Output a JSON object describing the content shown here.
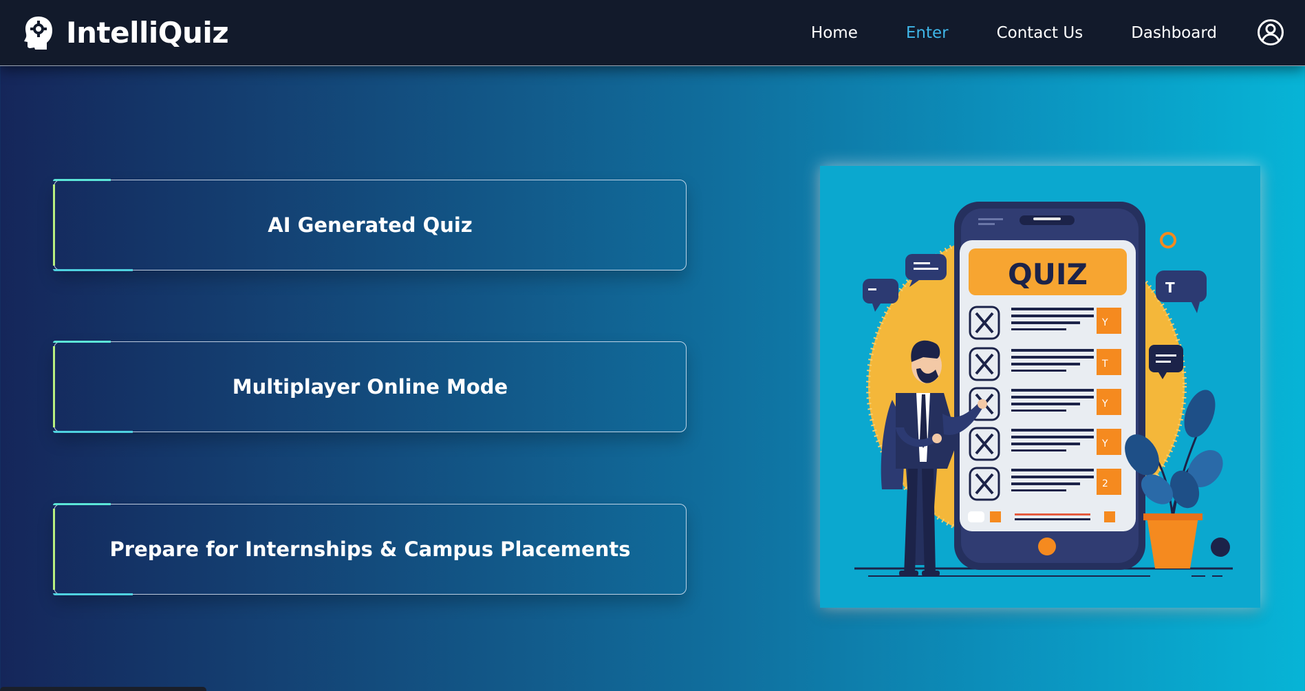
{
  "brand": {
    "name": "IntelliQuiz",
    "logo_icon": "brain-gear-icon"
  },
  "nav": {
    "items": [
      {
        "label": "Home",
        "active": false
      },
      {
        "label": "Enter",
        "active": true
      },
      {
        "label": "Contact Us",
        "active": false
      },
      {
        "label": "Dashboard",
        "active": false
      }
    ],
    "user_icon": "user-circle-icon",
    "active_color": "#3fb6e8"
  },
  "features": [
    {
      "label": "AI Generated Quiz"
    },
    {
      "label": "Multiplayer Online Mode"
    },
    {
      "label": "Prepare for Internships & Campus Placements"
    }
  ],
  "illustration": {
    "heading": "QUIZ",
    "row_marks": [
      "Y",
      "T",
      "Y",
      "Y",
      "2"
    ],
    "bubble_text": "T"
  },
  "colors": {
    "navbar_bg": "#121a2b",
    "gradient_start": "#15265a",
    "gradient_end": "#07b4d6"
  }
}
